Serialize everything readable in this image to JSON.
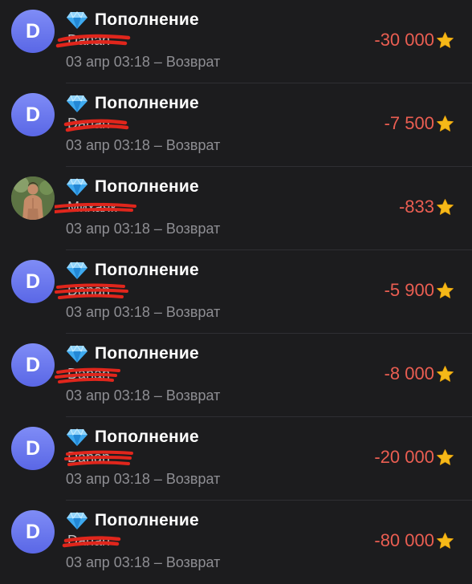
{
  "transactions": [
    {
      "avatar_letter": "D",
      "avatar_type": "letter",
      "title": "Пополнение",
      "name": "Danan",
      "meta": "03 апр 03:18 – Возврат",
      "amount": "-30 000"
    },
    {
      "avatar_letter": "D",
      "avatar_type": "letter",
      "title": "Пополнение",
      "name": "Danan",
      "meta": "03 апр 03:18 – Возврат",
      "amount": "-7 500"
    },
    {
      "avatar_letter": "",
      "avatar_type": "photo",
      "title": "Пополнение",
      "name": "Михаяк",
      "meta": "03 апр 03:18 – Возврат",
      "amount": "-833"
    },
    {
      "avatar_letter": "D",
      "avatar_type": "letter",
      "title": "Пополнение",
      "name": "Danan",
      "meta": "03 апр 03:18 – Возврат",
      "amount": "-5 900"
    },
    {
      "avatar_letter": "D",
      "avatar_type": "letter",
      "title": "Пополнение",
      "name": "Danan",
      "meta": "03 апр 03:18 – Возврат",
      "amount": "-8 000"
    },
    {
      "avatar_letter": "D",
      "avatar_type": "letter",
      "title": "Пополнение",
      "name": "Danan",
      "meta": "03 апр 03:18 – Возврат",
      "amount": "-20 000"
    },
    {
      "avatar_letter": "D",
      "avatar_type": "letter",
      "title": "Пополнение",
      "name": "Danan",
      "meta": "03 апр 03:18 – Возврат",
      "amount": "-80 000"
    }
  ],
  "icons": {
    "title_icon": "diamond-icon",
    "amount_icon": "star-icon"
  },
  "colors": {
    "background": "#1c1c1e",
    "avatar": "#6b78ee",
    "amount_negative": "#eb5e52",
    "star": "#f5b818",
    "diamond": "#3ea9ef",
    "redaction": "#e0261c"
  }
}
